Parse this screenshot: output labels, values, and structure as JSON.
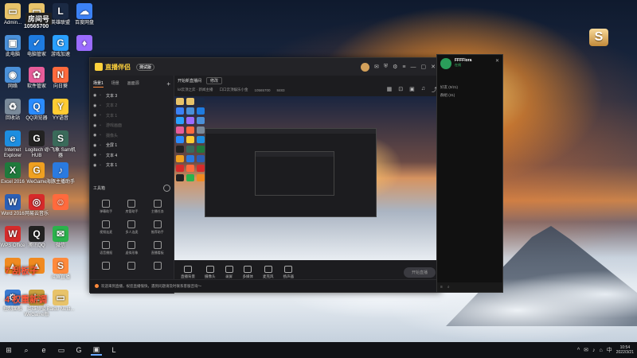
{
  "desktop": {
    "icons": [
      {
        "label": "Admin...",
        "col": 0,
        "row": 0,
        "color": "#e8c36a",
        "glyph": "▭"
      },
      {
        "label": "",
        "col": 1,
        "row": 0,
        "color": "#e8c36a",
        "glyph": "▭"
      },
      {
        "label": "英雄联盟",
        "col": 2,
        "row": 0,
        "color": "#1b2a44",
        "glyph": "L"
      },
      {
        "label": "百度网盘",
        "col": 3,
        "row": 0,
        "color": "#3c82f6",
        "glyph": "☁"
      },
      {
        "label": "此电脑",
        "col": 0,
        "row": 1,
        "color": "#4a90d9",
        "glyph": "▣"
      },
      {
        "label": "电脑管家",
        "col": 1,
        "row": 1,
        "color": "#1e7be0",
        "glyph": "✓"
      },
      {
        "label": "游戏加速",
        "col": 2,
        "row": 1,
        "color": "#2aa0ff",
        "glyph": "G"
      },
      {
        "label": "",
        "col": 3,
        "row": 1,
        "color": "#9b6cff",
        "glyph": "♦"
      },
      {
        "label": "网络",
        "col": 0,
        "row": 2,
        "color": "#4a90d9",
        "glyph": "◉"
      },
      {
        "label": "软件管家",
        "col": 1,
        "row": 2,
        "color": "#e85d9a",
        "glyph": "✿"
      },
      {
        "label": "向日葵",
        "col": 2,
        "row": 2,
        "color": "#ff6a3d",
        "glyph": "N"
      },
      {
        "label": "回收站",
        "col": 0,
        "row": 3,
        "color": "#7a8a9a",
        "glyph": "♻"
      },
      {
        "label": "QQ浏览器",
        "col": 1,
        "row": 3,
        "color": "#2a8cff",
        "glyph": "Q"
      },
      {
        "label": "YY语音",
        "col": 2,
        "row": 3,
        "color": "#ffcc33",
        "glyph": "Y"
      },
      {
        "label": "Internet Explorer",
        "col": 0,
        "row": 4,
        "color": "#1d8ee0",
        "glyph": "e"
      },
      {
        "label": "Logitech G HUB",
        "col": 1,
        "row": 4,
        "color": "#222222",
        "glyph": "G"
      },
      {
        "label": "小飞象 Sam机器",
        "col": 2,
        "row": 4,
        "color": "#3a6a5a",
        "glyph": "S"
      },
      {
        "label": "Excel 2016",
        "col": 0,
        "row": 5,
        "color": "#1f7a3c",
        "glyph": "X"
      },
      {
        "label": "WeGame",
        "col": 1,
        "row": 5,
        "color": "#f0a020",
        "glyph": "G"
      },
      {
        "label": "海豚主播助手",
        "col": 2,
        "row": 5,
        "color": "#2a7ae0",
        "glyph": "♪"
      },
      {
        "label": "Word 2016",
        "col": 0,
        "row": 6,
        "color": "#2b5fb5",
        "glyph": "W"
      },
      {
        "label": "网易云音乐",
        "col": 1,
        "row": 6,
        "color": "#d62a2a",
        "glyph": "◎"
      },
      {
        "label": "",
        "col": 2,
        "row": 6,
        "color": "#ff6a3d",
        "glyph": "☺"
      },
      {
        "label": "WPS Office",
        "col": 0,
        "row": 7,
        "color": "#d52b2b",
        "glyph": "W"
      },
      {
        "label": "腾讯QQ",
        "col": 1,
        "row": 7,
        "color": "#222222",
        "glyph": "Q"
      },
      {
        "label": "微信",
        "col": 2,
        "row": 7,
        "color": "#2bb24c",
        "glyph": "✉"
      },
      {
        "label": "",
        "col": 0,
        "row": 8,
        "color": "#f08a20",
        "glyph": "▲"
      },
      {
        "label": "",
        "col": 1,
        "row": 8,
        "color": "#f08a20",
        "glyph": "▲"
      },
      {
        "label": "斗鱼直播",
        "col": 2,
        "row": 8,
        "color": "#ff8a3c",
        "glyph": "S"
      },
      {
        "label": "控制面板",
        "col": 0,
        "row": 9,
        "color": "#3a7ad0",
        "glyph": "⚙"
      },
      {
        "label": "英雄联盟 WeGame版",
        "col": 1,
        "row": 9,
        "color": "#c8a040",
        "glyph": "L"
      },
      {
        "label": "Baidu Netd...",
        "col": 2,
        "row": 9,
        "color": "#e8c36a",
        "glyph": "▭"
      }
    ],
    "overlay": {
      "room_label": "房间号",
      "room_number": "10565700",
      "line1": "7  刮板子",
      "line2": "4  权重新调"
    }
  },
  "app": {
    "logo_text": "直播伴侣",
    "badge": "测试版",
    "tabs": [
      "场景1",
      "场景",
      "画面源"
    ],
    "sources": [
      {
        "label": "文本 3",
        "dim": false
      },
      {
        "label": "文本 2",
        "dim": true
      },
      {
        "label": "文本 1",
        "dim": true
      },
      {
        "label": "游戏画面",
        "dim": true
      },
      {
        "label": "摄像头",
        "dim": true
      },
      {
        "label": "全屏 1",
        "dim": false
      },
      {
        "label": "文本 4",
        "dim": false
      },
      {
        "label": "文本 1",
        "dim": false
      }
    ],
    "toolbox_label": "工具箱",
    "tools": [
      "弹幕助手",
      "房管助手",
      "主播任务",
      "视频连麦",
      "多人连麦",
      "推荐助手",
      "语音播报",
      "虚拟形象",
      "直播看板",
      "",
      "",
      ""
    ],
    "room_title": "开始新直播间",
    "edit_label": "修改",
    "info_items": [
      "lol云顶之弈 · 新闻主播",
      "口口云顶娱乐小金",
      "10565700",
      "8483"
    ],
    "bottom_buttons": [
      "直播背景",
      "摄像头",
      "录屏",
      "多媒体",
      "麦克风",
      "扬声器"
    ],
    "start_live": "开始直播",
    "status_text": "欢迎来到直播，祝您直播愉快，遇到问题请及时联系客服咨询～"
  },
  "chat": {
    "username": "FFFFlora",
    "status": "在线",
    "rows": [
      "好友 (0/21)",
      "群组 (31)"
    ],
    "footer": [
      "≡",
      "⌕"
    ]
  },
  "taskbar": {
    "items": [
      "⊞",
      "⌕",
      "e",
      "▭",
      "G",
      "▣",
      "L"
    ],
    "tray": [
      "^",
      "✉",
      "♪",
      "⌂",
      "中"
    ],
    "time": "10:54",
    "date": "2022/3/21"
  }
}
